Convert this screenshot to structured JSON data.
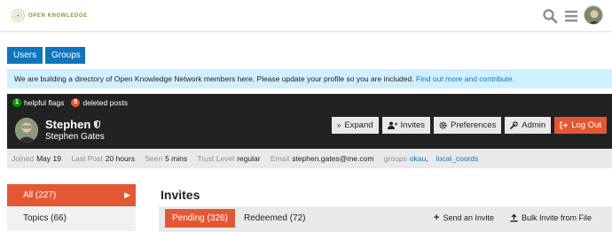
{
  "header": {
    "logo_text": "OPEN KNOWLEDGE",
    "search_icon": "search-icon",
    "menu_icon": "hamburger-icon"
  },
  "nav": {
    "users": "Users",
    "groups": "Groups"
  },
  "notice": {
    "text": "We are building a directory of Open Knowledge Network members here. Please update your profile so you are included. ",
    "link": "Find out more and contribute."
  },
  "flags": {
    "helpful_count": "1",
    "helpful_label": "helpful flags",
    "deleted_count": "5",
    "deleted_label": "deleted posts"
  },
  "profile": {
    "username": "Stephen",
    "full_name": "Stephen Gates",
    "actions": {
      "expand": "Expand",
      "invites": "Invites",
      "preferences": "Preferences",
      "admin": "Admin",
      "logout": "Log Out"
    }
  },
  "meta": {
    "joined_label": "Joined",
    "joined": "May 19",
    "last_post_label": "Last Post",
    "last_post": "20 hours",
    "seen_label": "Seen",
    "seen": "5 mins",
    "trust_label": "Trust Level",
    "trust": "regular",
    "email_label": "Email",
    "email": "stephen.gates@me.com",
    "groups_label": "groups",
    "group1": "okau",
    "group2": "local_coords"
  },
  "leftnav": {
    "all": "All (227)",
    "topics": "Topics (66)"
  },
  "invites": {
    "title": "Invites",
    "pending": "Pending (326)",
    "redeemed": "Redeemed (72)",
    "send": "Send an Invite",
    "bulk": "Bulk Invite from File"
  },
  "colors": {
    "accent": "#e45735",
    "primary": "#0e76bd",
    "dark": "#222222",
    "notice": "#d1f0ff"
  }
}
